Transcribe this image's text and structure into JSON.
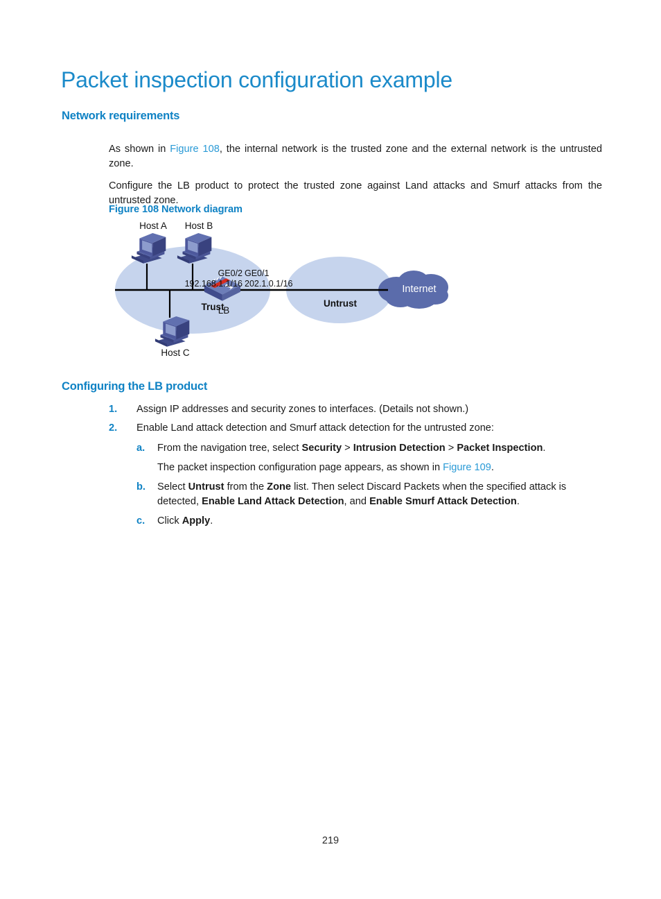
{
  "document": {
    "title": "Packet inspection configuration example",
    "page_number": "219"
  },
  "sections": {
    "network_requirements": {
      "heading": "Network requirements",
      "paragraph_1_pre": "As shown in ",
      "paragraph_1_xref": "Figure 108",
      "paragraph_1_post": ", the internal network is the trusted zone and the external network is the untrusted zone.",
      "paragraph_2": "Configure the LB product to protect the trusted zone against Land attacks and Smurf attacks from the untrusted zone.",
      "figure_caption": "Figure 108 Network diagram"
    },
    "configuring_lb": {
      "heading": "Configuring the LB product",
      "step1_marker": "1.",
      "step1_text": "Assign IP addresses and security zones to interfaces. (Details not shown.)",
      "step2_marker": "2.",
      "step2_text": "Enable Land attack detection and Smurf attack detection for the untrusted zone:",
      "step_a_marker": "a.",
      "step_a_pre": "From the navigation tree, select ",
      "step_a_b1": "Security",
      "step_a_sep1": " > ",
      "step_a_b2": "Intrusion Detection",
      "step_a_sep2": " > ",
      "step_a_b3": "Packet Inspection",
      "step_a_post": ".",
      "step_a_note_pre": "The packet inspection configuration page appears, as shown in ",
      "step_a_note_xref": "Figure 109",
      "step_a_note_post": ".",
      "step_b_marker": "b.",
      "step_b_pre": "Select ",
      "step_b_b1": "Untrust",
      "step_b_mid1": " from the ",
      "step_b_b2": "Zone",
      "step_b_mid2": " list. Then select Discard Packets when the specified attack is detected, ",
      "step_b_b3": "Enable Land Attack Detection",
      "step_b_mid3": ", and ",
      "step_b_b4": "Enable Smurf Attack Detection",
      "step_b_post": ".",
      "step_c_marker": "c.",
      "step_c_pre": "Click ",
      "step_c_b1": "Apply",
      "step_c_post": "."
    }
  },
  "figure": {
    "hosts": [
      {
        "label": "Host A"
      },
      {
        "label": "Host B"
      },
      {
        "label": "Host C"
      }
    ],
    "zones": {
      "trust_label": "Trust",
      "untrust_label": "Untrust"
    },
    "device": {
      "label": "LB"
    },
    "interfaces": {
      "left_name": "GE0/2",
      "left_address": "192.168.1.1/16",
      "right_name": "GE0/1",
      "right_address": "202.1.0.1/16"
    },
    "cloud": {
      "label": "Internet"
    },
    "colors": {
      "zone_fill": "#c6d4ed",
      "cloud_fill": "#5b6cab",
      "device_top": "#6d7eb8",
      "device_front": "#4a5a96",
      "device_accent": "#d62b1f",
      "host_body": "#4a5596",
      "host_screen": "#8d9ccd",
      "link_line": "#000000"
    }
  },
  "theme": {
    "heading_blue": "#0f82c4",
    "title_blue": "#1b8ac9",
    "xref_blue": "#2a9ad6",
    "body_text": "#1a1a1a"
  }
}
